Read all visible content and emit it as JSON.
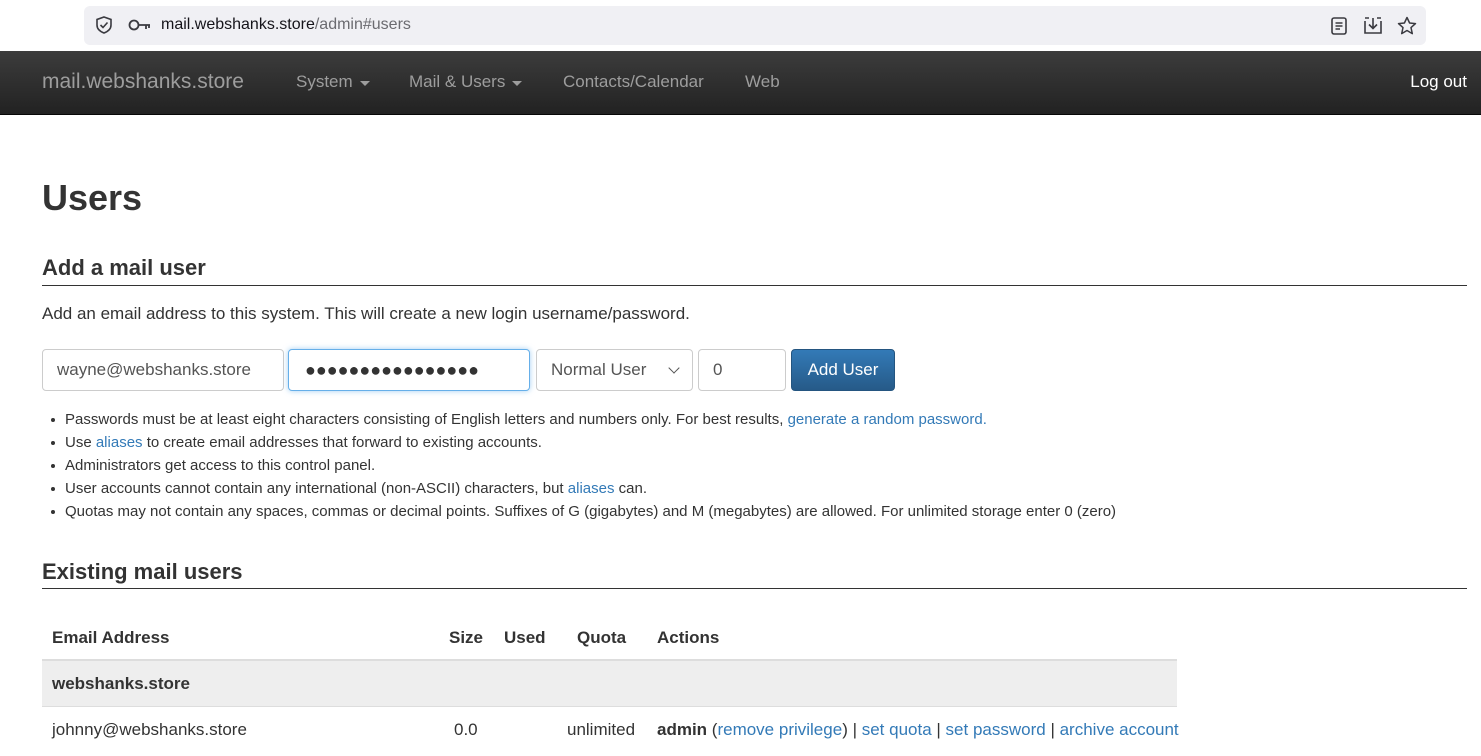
{
  "browser": {
    "url_host": "mail.webshanks.store",
    "url_path": "/admin#users"
  },
  "navbar": {
    "brand": "mail.webshanks.store",
    "items": [
      {
        "label": "System",
        "dropdown": true
      },
      {
        "label": "Mail & Users",
        "dropdown": true
      },
      {
        "label": "Contacts/Calendar",
        "dropdown": false
      },
      {
        "label": "Web",
        "dropdown": false
      }
    ],
    "logout": "Log out"
  },
  "page": {
    "title": "Users"
  },
  "add_user": {
    "heading": "Add a mail user",
    "lead": "Add an email address to this system. This will create a new login username/password.",
    "email_value": "wayne@webshanks.store",
    "password_dots": "●●●●●●●●●●●●●●●●",
    "privilege_selected": "Normal User",
    "quota_value": "0",
    "submit_label": "Add User",
    "notes": {
      "n1_text": "Passwords must be at least eight characters consisting of English letters and numbers only. For best results, ",
      "n1_link": "generate a random password",
      "n1_end": ".",
      "n2_pre": "Use ",
      "n2_link": "aliases",
      "n2_post": " to create email addresses that forward to existing accounts.",
      "n3": "Administrators get access to this control panel.",
      "n4_pre": "User accounts cannot contain any international (non-ASCII) characters, but ",
      "n4_link": "aliases",
      "n4_post": " can.",
      "n5": "Quotas may not contain any spaces, commas or decimal points. Suffixes of G (gigabytes) and M (megabytes) are allowed. For unlimited storage enter 0 (zero)"
    }
  },
  "existing": {
    "heading": "Existing mail users",
    "columns": {
      "email": "Email Address",
      "size": "Size",
      "used": "Used",
      "quota": "Quota",
      "actions": "Actions"
    },
    "group": "webshanks.store",
    "row": {
      "email": "johnny@webshanks.store",
      "size": "0.0",
      "used": "",
      "quota": "unlimited",
      "role": "admin",
      "remove_privilege": "remove privilege",
      "set_quota": "set quota",
      "set_password": "set password",
      "archive_account": "archive account"
    }
  }
}
